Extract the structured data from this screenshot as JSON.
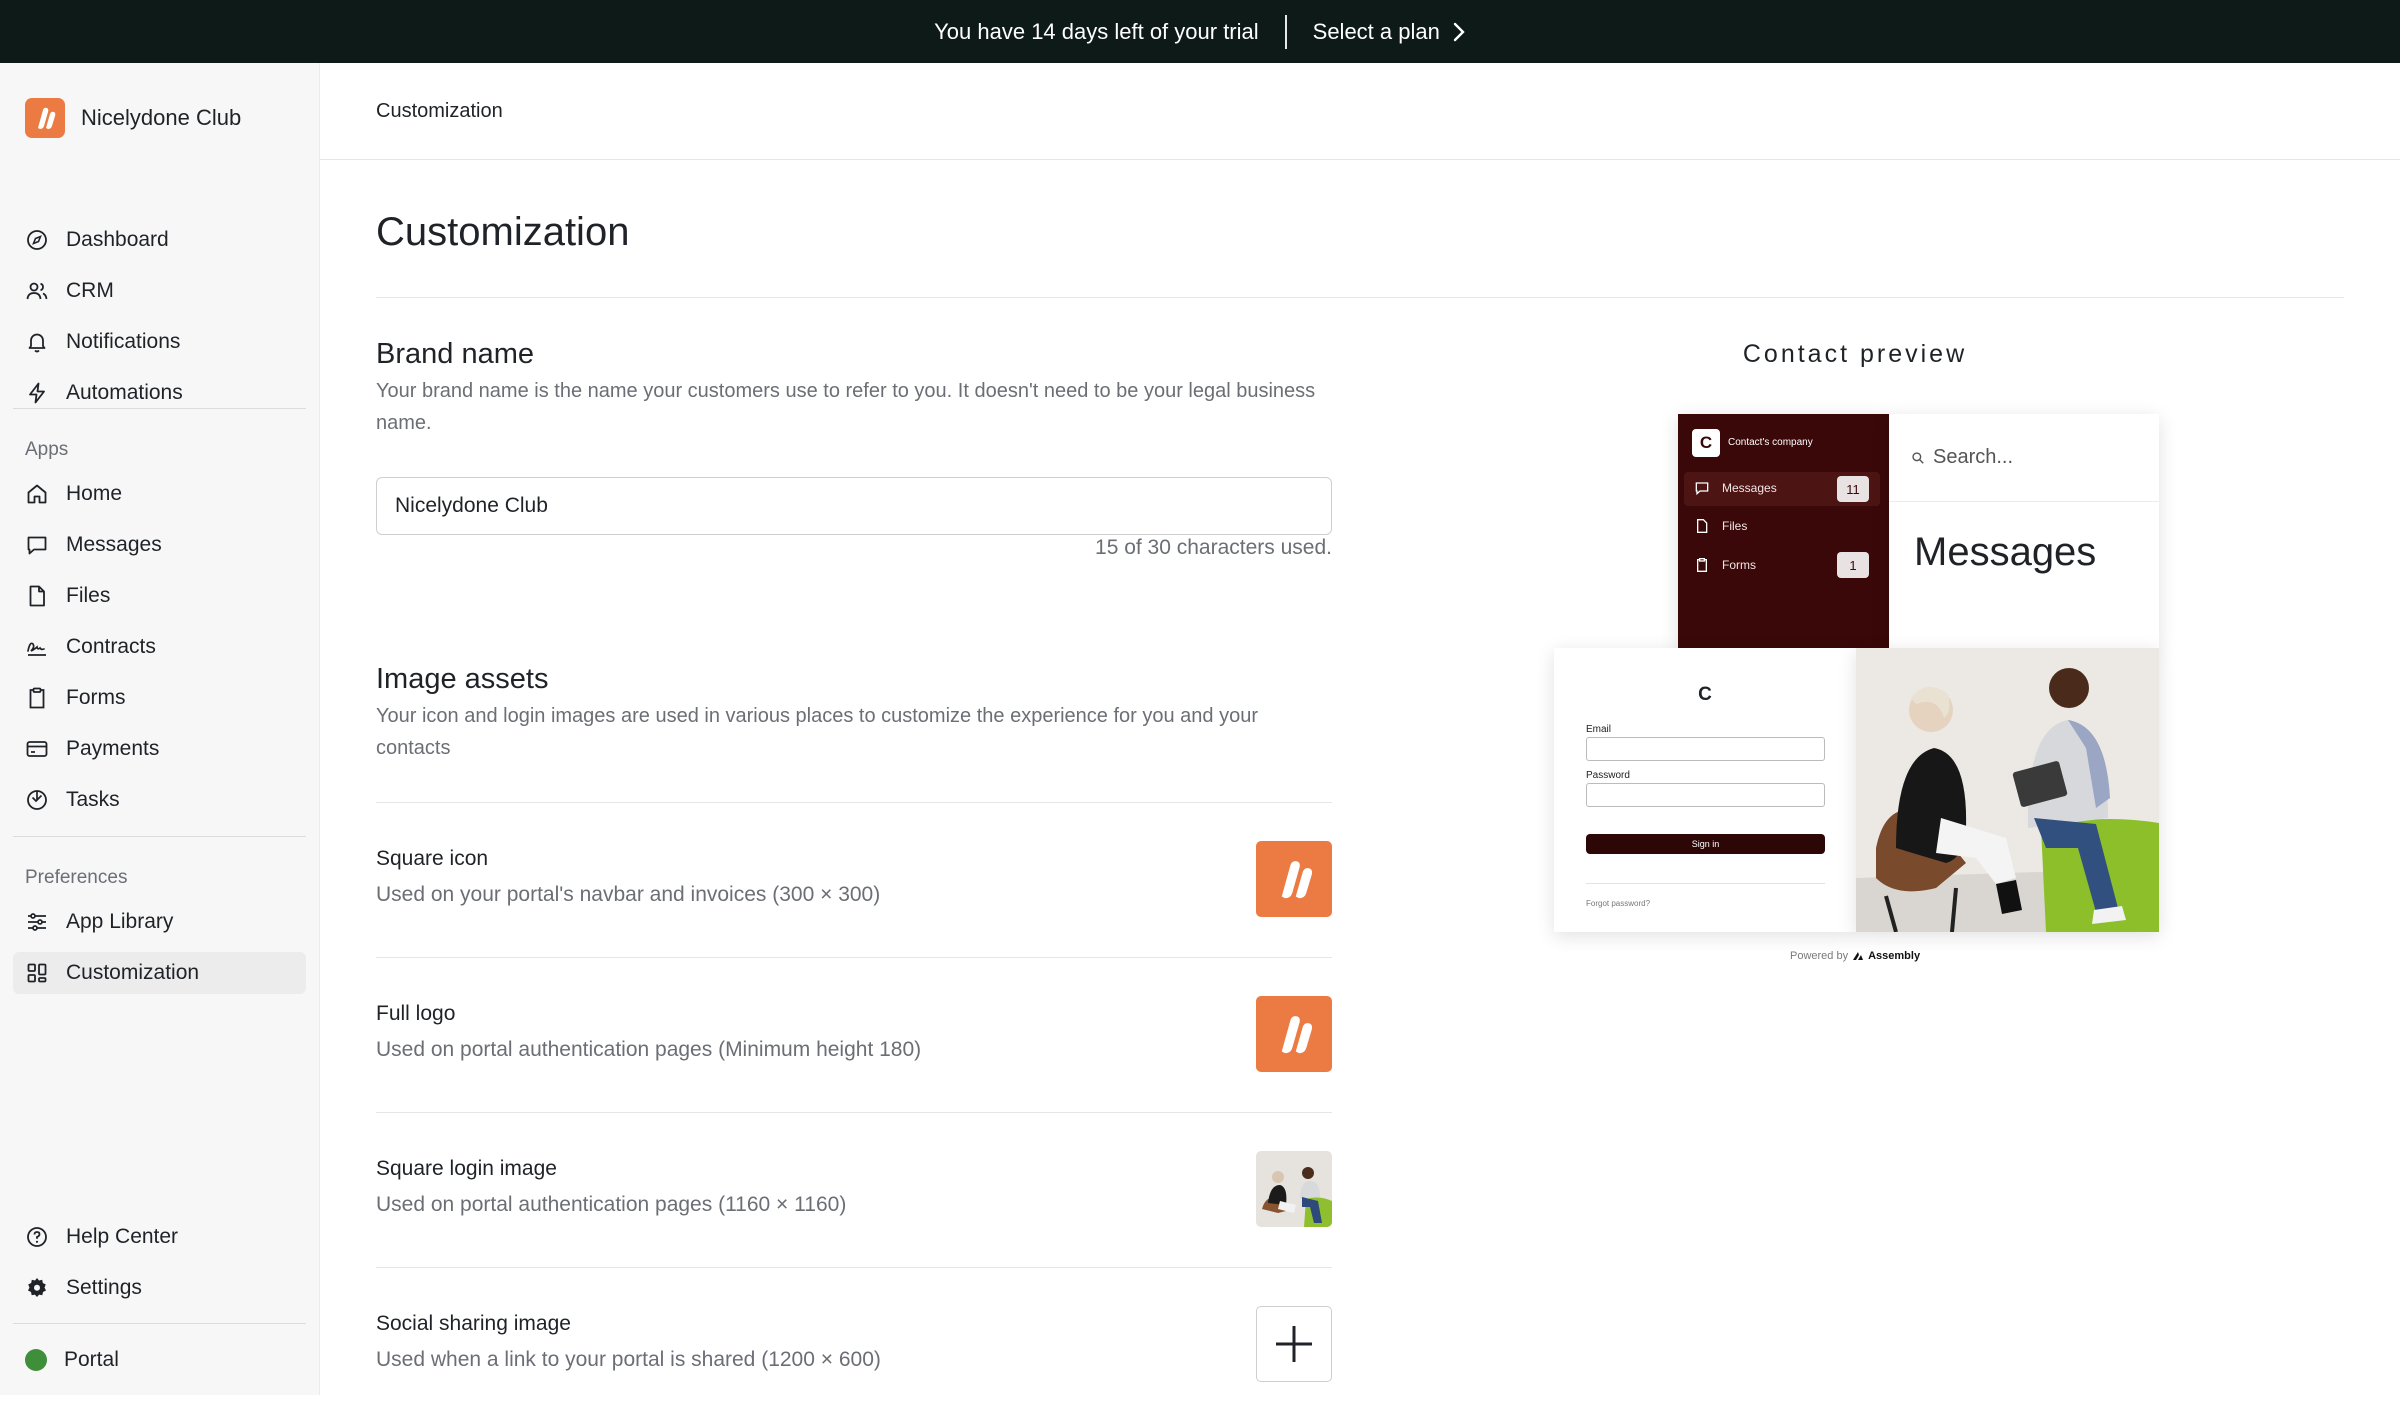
{
  "trial": {
    "message": "You have 14 days left of your trial",
    "cta": "Select a plan"
  },
  "workspace": {
    "name": "Nicelydone Club"
  },
  "nav": {
    "main": [
      {
        "label": "Dashboard",
        "icon": "compass-icon"
      },
      {
        "label": "CRM",
        "icon": "users-icon"
      },
      {
        "label": "Notifications",
        "icon": "bell-icon"
      },
      {
        "label": "Automations",
        "icon": "bolt-icon"
      }
    ],
    "apps_label": "Apps",
    "apps": [
      {
        "label": "Home",
        "icon": "home-icon"
      },
      {
        "label": "Messages",
        "icon": "message-icon"
      },
      {
        "label": "Files",
        "icon": "file-icon"
      },
      {
        "label": "Contracts",
        "icon": "signature-icon"
      },
      {
        "label": "Forms",
        "icon": "clipboard-icon"
      },
      {
        "label": "Payments",
        "icon": "card-icon"
      },
      {
        "label": "Tasks",
        "icon": "tasks-icon"
      }
    ],
    "preferences_label": "Preferences",
    "preferences": [
      {
        "label": "App Library",
        "icon": "sliders-icon"
      },
      {
        "label": "Customization",
        "icon": "grid-icon",
        "active": true
      }
    ],
    "bottom": [
      {
        "label": "Help Center",
        "icon": "help-icon"
      },
      {
        "label": "Settings",
        "icon": "gear-icon"
      }
    ],
    "portal": "Portal"
  },
  "topbar": {
    "breadcrumb": "Customization"
  },
  "page": {
    "title": "Customization",
    "brand": {
      "heading": "Brand name",
      "description": "Your brand name is the name your customers use to refer to you. It doesn't need to be your legal business name.",
      "value": "Nicelydone Club",
      "char_count": "15 of 30 characters used."
    },
    "assets": {
      "heading": "Image assets",
      "description": "Your icon and login images are used in various places to customize the experience for you and your contacts",
      "rows": [
        {
          "title": "Square icon",
          "desc": "Used on your portal's navbar and invoices (300 × 300)"
        },
        {
          "title": "Full logo",
          "desc": "Used on portal authentication pages (Minimum height 180)"
        },
        {
          "title": "Square login image",
          "desc": "Used on portal authentication pages (1160 × 1160)"
        },
        {
          "title": "Social sharing image",
          "desc": "Used when a link to your portal is shared (1200 × 600)"
        }
      ]
    }
  },
  "preview": {
    "label": "Contact preview",
    "company": "Contact's company",
    "company_initial": "C",
    "items": [
      {
        "label": "Messages",
        "badge": "11"
      },
      {
        "label": "Files",
        "badge": ""
      },
      {
        "label": "Forms",
        "badge": "1"
      }
    ],
    "search_placeholder": "Search...",
    "heading": "Messages",
    "login": {
      "initial": "C",
      "email_label": "Email",
      "password_label": "Password",
      "signin": "Sign in",
      "forgot": "Forgot password?"
    },
    "powered_by": "Powered by",
    "powered_brand": "Assembly"
  }
}
